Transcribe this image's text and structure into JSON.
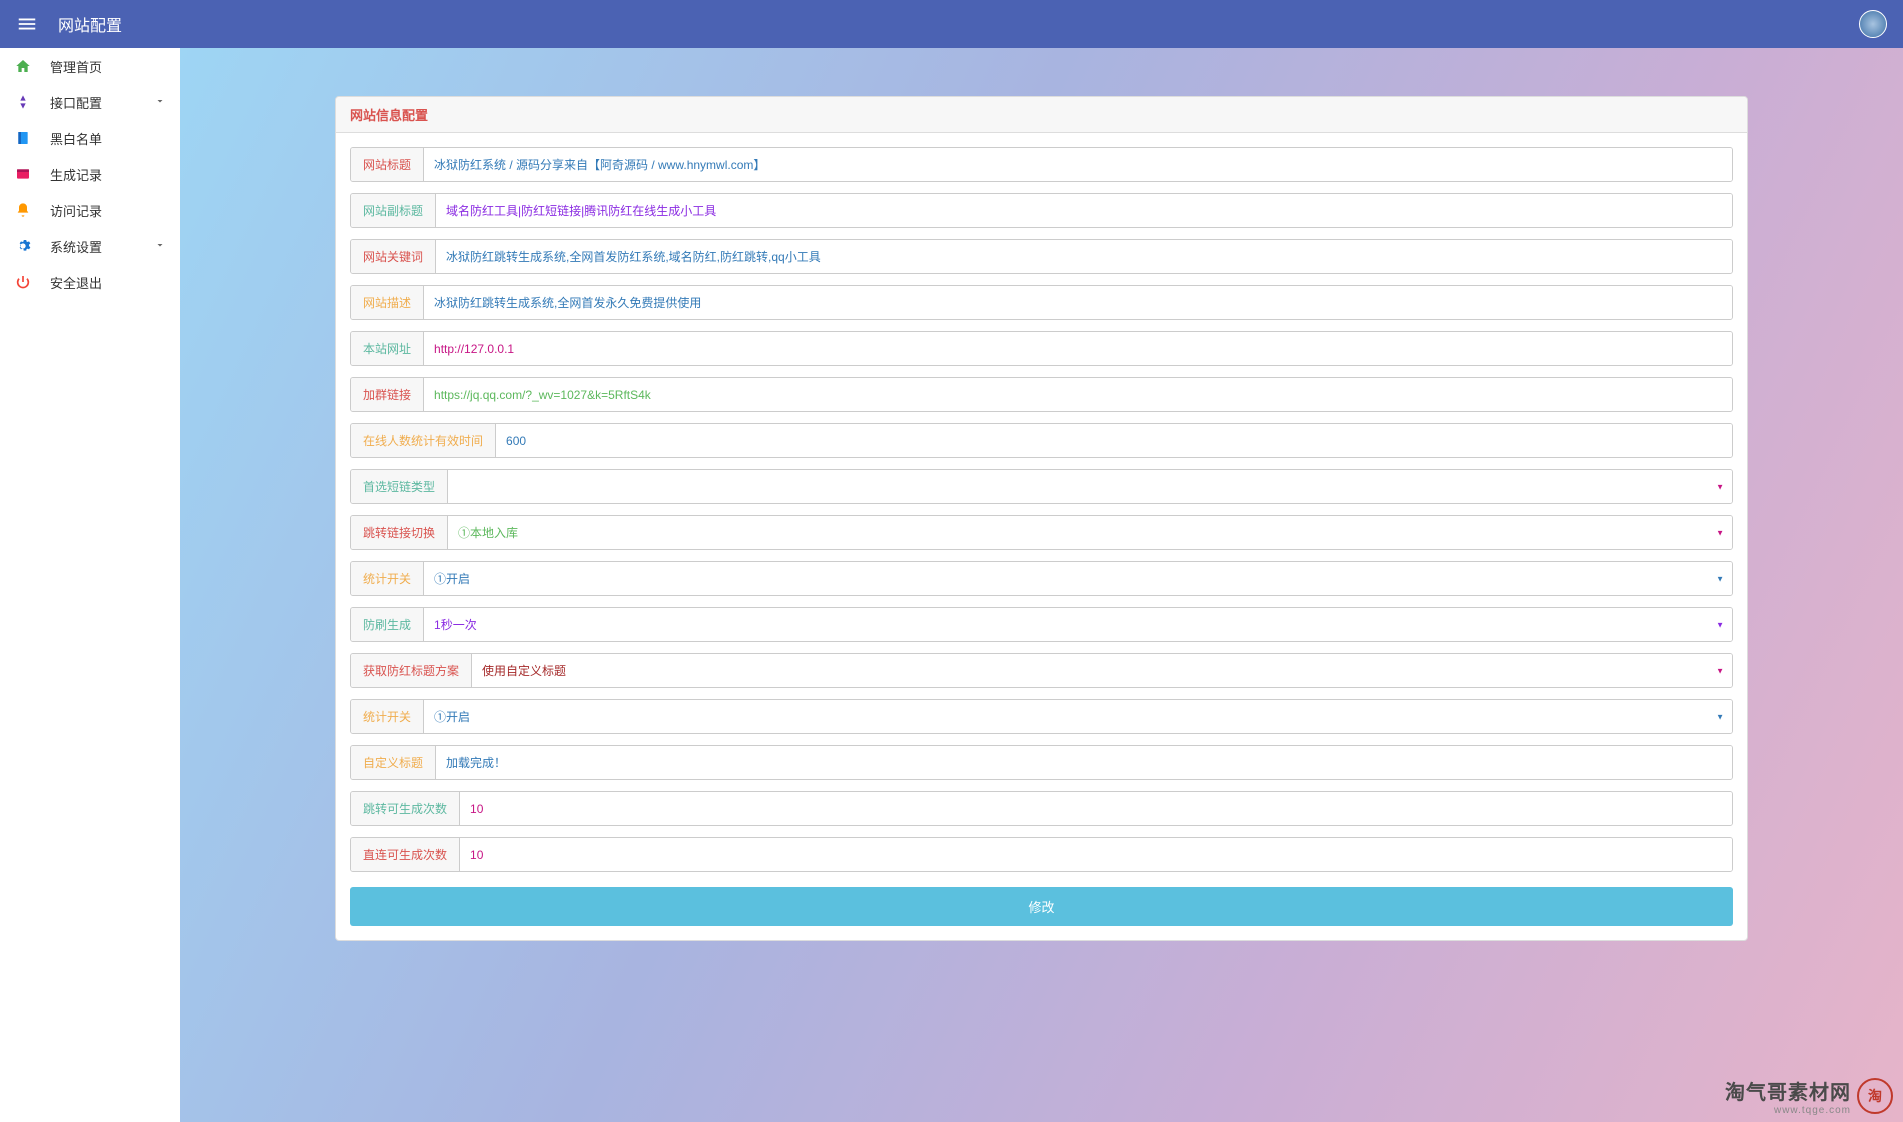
{
  "header": {
    "title": "网站配置"
  },
  "sidebar": {
    "items": [
      {
        "label": "管理首页",
        "icon": "home",
        "color": "#4CAF50"
      },
      {
        "label": "接口配置",
        "icon": "nav",
        "color": "#673AB7",
        "expandable": true
      },
      {
        "label": "黑白名单",
        "icon": "book",
        "color": "#2196F3"
      },
      {
        "label": "生成记录",
        "icon": "web",
        "color": "#e91e63"
      },
      {
        "label": "访问记录",
        "icon": "bell",
        "color": "#ff9800"
      },
      {
        "label": "系统设置",
        "icon": "gear",
        "color": "#1976D2",
        "expandable": true
      },
      {
        "label": "安全退出",
        "icon": "power",
        "color": "#f44336"
      }
    ]
  },
  "panel": {
    "title": "网站信息配置"
  },
  "form": {
    "site_title": {
      "label": "网站标题",
      "value": "冰狱防红系统 / 源码分享来自【阿奇源码 / www.hnymwl.com】"
    },
    "site_subtitle": {
      "label": "网站副标题",
      "value": "域名防红工具|防红短链接|腾讯防红在线生成小工具"
    },
    "site_keywords": {
      "label": "网站关键词",
      "value": "冰狱防红跳转生成系统,全网首发防红系统,域名防红,防红跳转,qq小工具"
    },
    "site_desc": {
      "label": "网站描述",
      "value": "冰狱防红跳转生成系统,全网首发永久免费提供使用"
    },
    "site_url": {
      "label": "本站网址",
      "value": "http://127.0.0.1"
    },
    "group_link": {
      "label": "加群链接",
      "value": "https://jq.qq.com/?_wv=1027&k=5RftS4k"
    },
    "online_stat_time": {
      "label": "在线人数统计有效时间",
      "value": "600"
    },
    "shortlink_type": {
      "label": "首选短链类型",
      "value": ""
    },
    "redirect_switch": {
      "label": "跳转链接切换",
      "value": "①本地入库"
    },
    "stat_switch1": {
      "label": "统计开关",
      "value": "①开启"
    },
    "anti_brush": {
      "label": "防刷生成",
      "value": "1秒一次"
    },
    "title_scheme": {
      "label": "获取防红标题方案",
      "value": "使用自定义标题"
    },
    "stat_switch2": {
      "label": "统计开关",
      "value": "①开启"
    },
    "custom_title": {
      "label": "自定义标题",
      "value": "加载完成！"
    },
    "jump_limit": {
      "label": "跳转可生成次数",
      "value": "10"
    },
    "direct_limit": {
      "label": "直连可生成次数",
      "value": "10"
    },
    "submit": "修改"
  },
  "watermark": {
    "cn": "淘气哥素材网",
    "en": "www.tqge.com"
  }
}
